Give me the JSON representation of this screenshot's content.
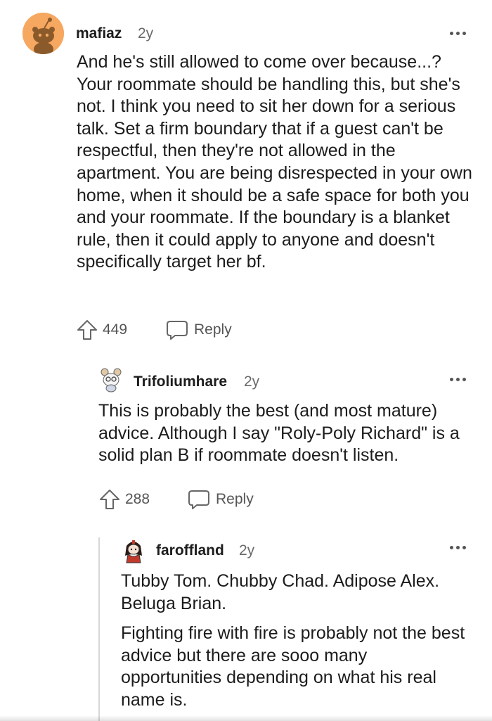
{
  "comments": [
    {
      "username": "mafiaz",
      "age": "2y",
      "body": [
        "And he's still allowed to come over because...? Your roommate should be handling this, but she's not. I think you need to sit her down for a serious talk. Set a firm boundary that if a guest can't be respectful, then they're not allowed in the apartment. You are being disrespected in your own home, when it should be a safe space for both you and your roommate. If the boundary is a blanket rule, then it could apply to anyone and doesn't specifically target her bf."
      ],
      "votes": "449",
      "reply_label": "Reply"
    },
    {
      "username": "Trifoliumhare",
      "age": "2y",
      "body": [
        "This is probably the best (and most mature) advice. Although I say \"Roly-Poly Richard\" is a solid plan B if roommate doesn't listen."
      ],
      "votes": "288",
      "reply_label": "Reply"
    },
    {
      "username": "faroffland",
      "age": "2y",
      "body": [
        "Tubby Tom. Chubby Chad. Adipose Alex. Beluga Brian.",
        "Fighting fire with fire is probably not the best advice but there are sooo many opportunities depending on what his real name is."
      ]
    }
  ],
  "icons": {
    "upvote": "arrow-up-outline-icon",
    "reply": "speech-bubble-icon",
    "more": "horizontal-ellipsis-icon"
  },
  "colors": {
    "text": "#1c1c1c",
    "meta": "#6a6a6a",
    "avatar_orange": "#f6a760",
    "thread_line": "#d7d7d7"
  }
}
